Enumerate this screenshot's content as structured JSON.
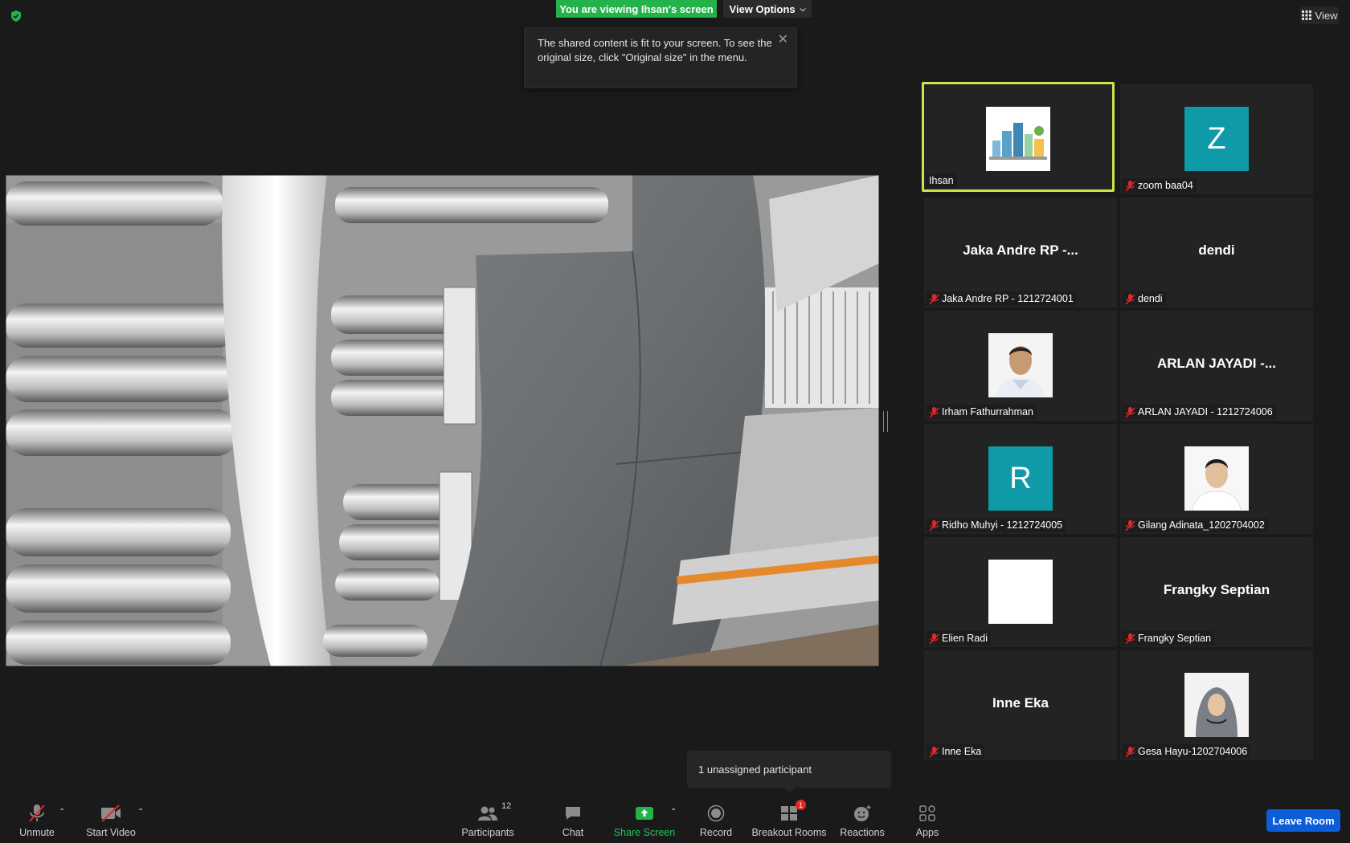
{
  "top": {
    "viewing_banner": "You are viewing Ihsan's screen",
    "view_options": "View Options",
    "view_button": "View"
  },
  "tooltip": {
    "text": "The shared content is fit to your screen. To see the original size, click \"Original size\" in the menu."
  },
  "participants": [
    {
      "name": "Ihsan",
      "type": "image",
      "active": true,
      "muted": false
    },
    {
      "name": "zoom baa04",
      "type": "initial",
      "initial": "Z",
      "muted": true
    },
    {
      "name": "Jaka Andre RP - 1212724001",
      "type": "text",
      "display": "Jaka Andre RP -...",
      "muted": true
    },
    {
      "name": "dendi",
      "type": "text",
      "display": "dendi",
      "muted": true
    },
    {
      "name": "Irham Fathurrahman",
      "type": "image",
      "muted": true
    },
    {
      "name": "ARLAN JAYADI - 1212724006",
      "type": "text",
      "display": "ARLAN  JAYADI  -...",
      "muted": true
    },
    {
      "name": "Ridho Muhyi - 1212724005",
      "type": "initial",
      "initial": "R",
      "muted": true
    },
    {
      "name": "Gilang Adinata_1202704002",
      "type": "image",
      "muted": true
    },
    {
      "name": "Elien Radi",
      "type": "image",
      "muted": true
    },
    {
      "name": "Frangky Septian",
      "type": "text",
      "display": "Frangky Septian",
      "muted": true
    },
    {
      "name": "Inne Eka",
      "type": "text",
      "display": "Inne Eka",
      "muted": true
    },
    {
      "name": "Gesa Hayu-1202704006",
      "type": "image",
      "muted": true
    }
  ],
  "popup": {
    "unassigned": "1 unassigned participant"
  },
  "toolbar": {
    "unmute": "Unmute",
    "start_video": "Start Video",
    "participants": "Participants",
    "participants_count": "12",
    "chat": "Chat",
    "share_screen": "Share Screen",
    "record": "Record",
    "breakout_rooms": "Breakout Rooms",
    "breakout_badge": "1",
    "reactions": "Reactions",
    "apps": "Apps",
    "leave_room": "Leave Room"
  },
  "colors": {
    "accent_green": "#23b34a",
    "active_speaker": "#cde44c",
    "avatar_teal": "#0e9aa7",
    "leave_blue": "#0e5dd8",
    "mute_red": "#e02828"
  }
}
